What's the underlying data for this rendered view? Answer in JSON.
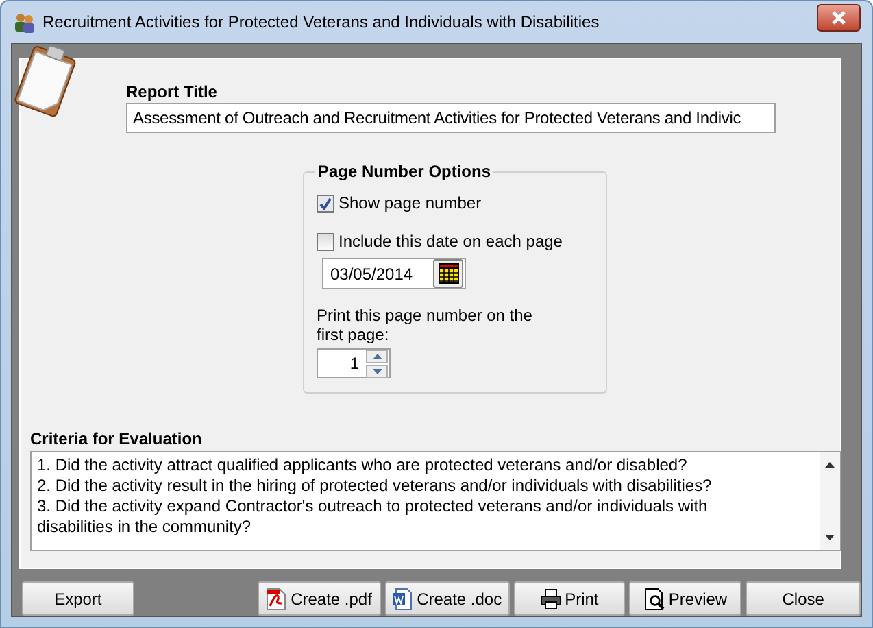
{
  "window": {
    "title": "Recruitment Activities for Protected Veterans and Individuals with Disabilities"
  },
  "report_title": {
    "label": "Report Title",
    "value": "Assessment of Outreach and Recruitment Activities for Protected Veterans and Indivic"
  },
  "page_number_options": {
    "legend": "Page Number Options",
    "checkboxes": [
      {
        "label": "Show page number",
        "checked": true
      },
      {
        "label": "Include this date on each page",
        "checked": false
      }
    ],
    "date": "03/05/2014",
    "first_page_label": "Print this page number on the first page:",
    "first_page_value": "1"
  },
  "criteria": {
    "label": "Criteria for Evaluation",
    "lines": [
      "1. Did the activity attract qualified applicants who are protected veterans and/or disabled?",
      "2. Did the activity result in the hiring of protected veterans and/or individuals with disabilities?",
      "3. Did the activity expand Contractor's outreach to protected veterans and/or individuals with disabilities in the community?"
    ]
  },
  "buttons": [
    {
      "label": "Export",
      "kind": "plain"
    },
    {
      "label": "Create .pdf",
      "kind": "pdf"
    },
    {
      "label": "Create .doc",
      "kind": "doc"
    },
    {
      "label": "Print",
      "kind": "print"
    },
    {
      "label": "Preview",
      "kind": "preview"
    },
    {
      "label": "Close",
      "kind": "plain"
    }
  ]
}
